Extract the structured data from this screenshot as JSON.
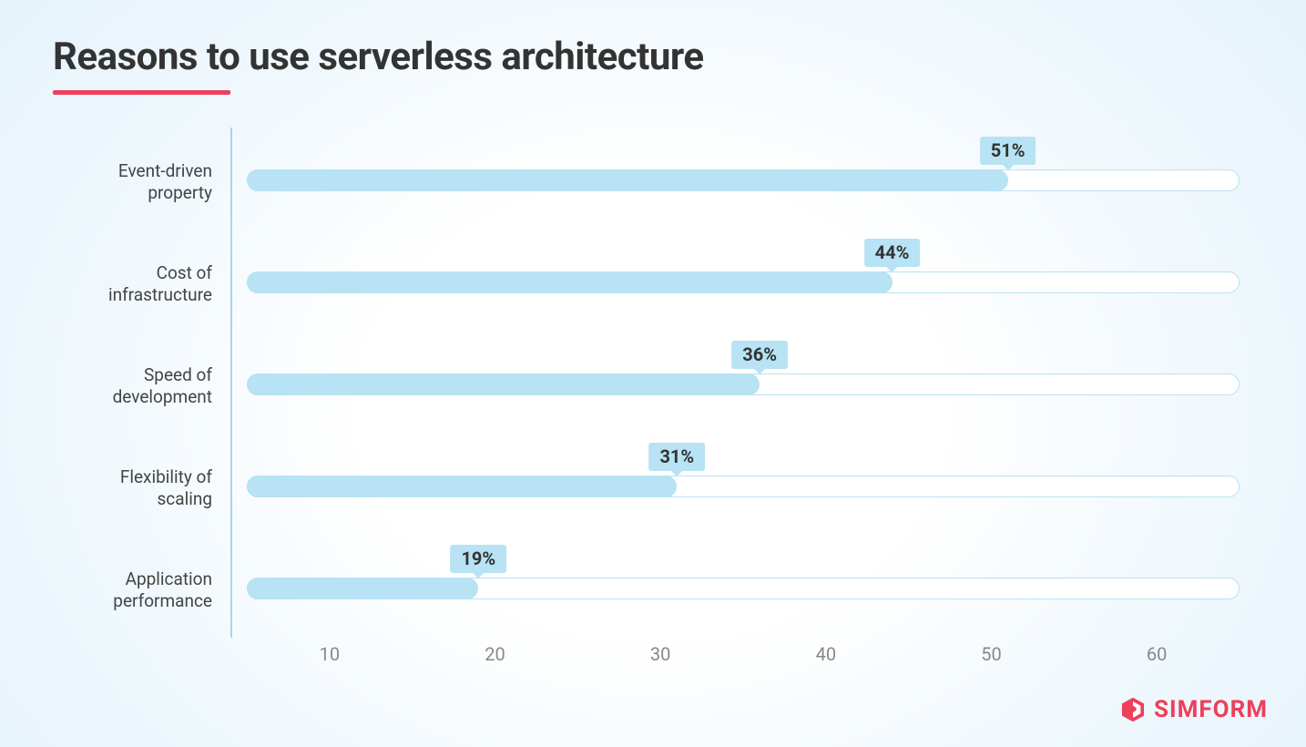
{
  "title": "Reasons to use serverless architecture",
  "brand": "SIMFORM",
  "colors": {
    "accent": "#ee3f5c",
    "bar": "#b7e3f4",
    "axis": "#a7d6ea"
  },
  "chart_data": {
    "type": "bar",
    "orientation": "horizontal",
    "title": "Reasons to use serverless architecture",
    "xlabel": "",
    "ylabel": "",
    "categories": [
      "Event-driven property",
      "Cost of infrastructure",
      "Speed of development",
      "Flexibility of scaling",
      "Application performance"
    ],
    "values": [
      51,
      44,
      36,
      31,
      19
    ],
    "value_labels": [
      "51%",
      "44%",
      "36%",
      "31%",
      "19%"
    ],
    "x_ticks": [
      10,
      20,
      30,
      40,
      50,
      60
    ],
    "xlim": [
      5,
      65
    ],
    "track_max": 65
  }
}
